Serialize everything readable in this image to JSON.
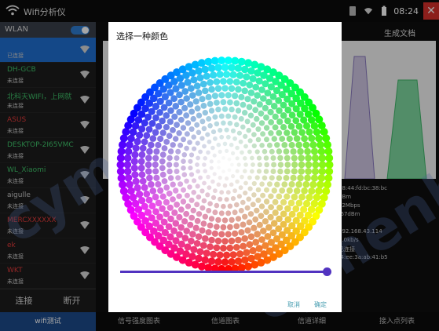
{
  "statusbar": {
    "app_title": "Wifi分析仪",
    "time": "08:24"
  },
  "wlan": {
    "label": "WLAN",
    "networks": [
      {
        "name": "",
        "status": "已连接",
        "color": "#ffffff",
        "selected": true
      },
      {
        "name": "DH-GCB",
        "status": "未连接",
        "color": "#3fc46a",
        "selected": false
      },
      {
        "name": "北科天WIFI，上网就",
        "status": "未连接",
        "color": "#3fc46a",
        "selected": false
      },
      {
        "name": "ASUS",
        "status": "未连接",
        "color": "#e33b3b",
        "selected": false
      },
      {
        "name": "DESKTOP-2I65VMC",
        "status": "未连接",
        "color": "#3fc46a",
        "selected": false
      },
      {
        "name": "WL_Xiaomi",
        "status": "未连接",
        "color": "#3fc46a",
        "selected": false
      },
      {
        "name": "aigulle",
        "status": "未连接",
        "color": "#c8c8c8",
        "selected": false
      },
      {
        "name": "MERCXXXXXX",
        "status": "未连接",
        "color": "#e33b3b",
        "selected": false
      },
      {
        "name": "ek",
        "status": "未连接",
        "color": "#e33b3b",
        "selected": false
      },
      {
        "name": "WKT",
        "status": "未连接",
        "color": "#e33b3b",
        "selected": false
      }
    ],
    "connect_label": "连接",
    "disconnect_label": "断开"
  },
  "main": {
    "generate_doc_label": "生成文档",
    "right_info": [
      "78:44:fd:bc:38:bc",
      "dBm",
      "72Mbps",
      "-67dBm",
      "",
      "192.168.43.114",
      "0.0kb/s",
      "已连接",
      "f4:ee:3a:ab:41:b5"
    ]
  },
  "tabs": [
    {
      "label": "wifi测试",
      "active": true
    },
    {
      "label": "信号强度图表",
      "active": false
    },
    {
      "label": "信道图表",
      "active": false
    },
    {
      "label": "信道详细",
      "active": false
    },
    {
      "label": "接入点列表",
      "active": false
    }
  ],
  "dialog": {
    "title": "选择一种颜色",
    "cancel_label": "取消",
    "ok_label": "确定",
    "slider_color": "#5133c0",
    "brightness": 1.0
  },
  "watermark": {
    "text": "cymenhie"
  }
}
